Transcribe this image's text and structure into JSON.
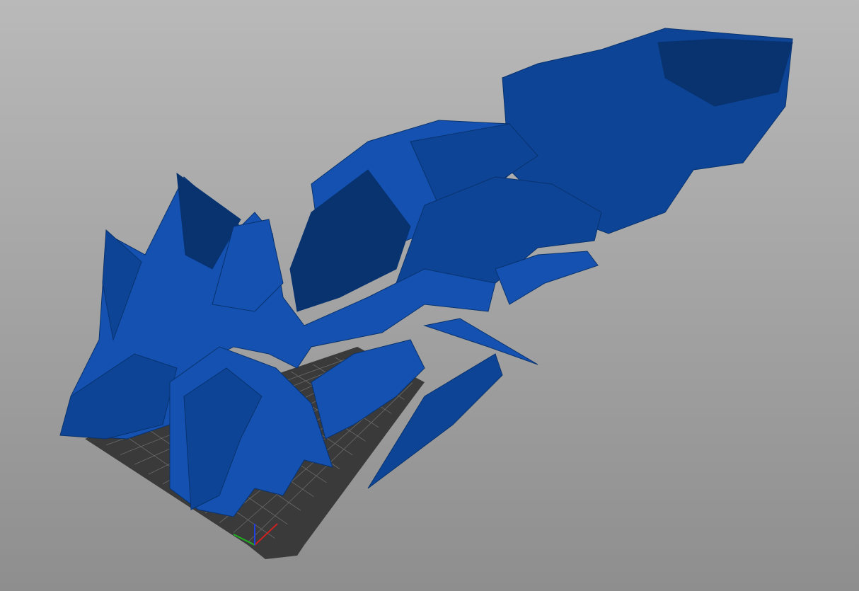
{
  "viewport": {
    "background_top": "#b9b9b9",
    "background_bottom": "#8e8e8e"
  },
  "bed": {
    "plate_color": "#3a3a3a",
    "grid_color": "#6a6a6a"
  },
  "model": {
    "color_light": "#1451b0",
    "color_mid": "#0d4496",
    "color_dark": "#08336f"
  },
  "axes": {
    "x_color": "#d02020",
    "y_color": "#20b020",
    "z_color": "#2040e0"
  }
}
